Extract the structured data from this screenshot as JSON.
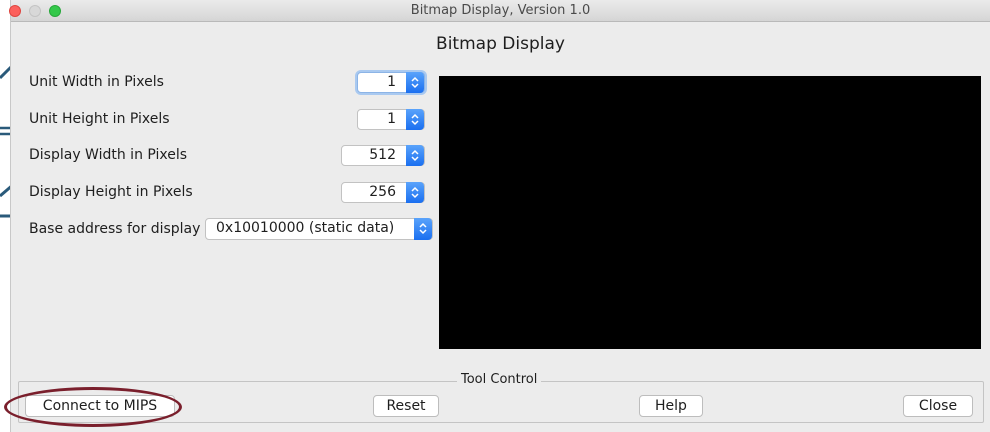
{
  "window": {
    "title": "Bitmap Display, Version 1.0"
  },
  "heading": "Bitmap Display",
  "settings": [
    {
      "label": "Unit Width in Pixels",
      "value": "1"
    },
    {
      "label": "Unit Height in Pixels",
      "value": "1"
    },
    {
      "label": "Display Width in Pixels",
      "value": "512"
    },
    {
      "label": "Display Height in Pixels",
      "value": "256"
    }
  ],
  "base_address": {
    "label": "Base address for display",
    "value": "0x10010000 (static data)"
  },
  "tool_control": {
    "legend": "Tool Control",
    "connect_label": "Connect to MIPS",
    "reset_label": "Reset",
    "help_label": "Help",
    "close_label": "Close"
  },
  "colors": {
    "display_background": "#000000",
    "annotation": "#7a1f2c",
    "accent": "#1a6ff0"
  }
}
